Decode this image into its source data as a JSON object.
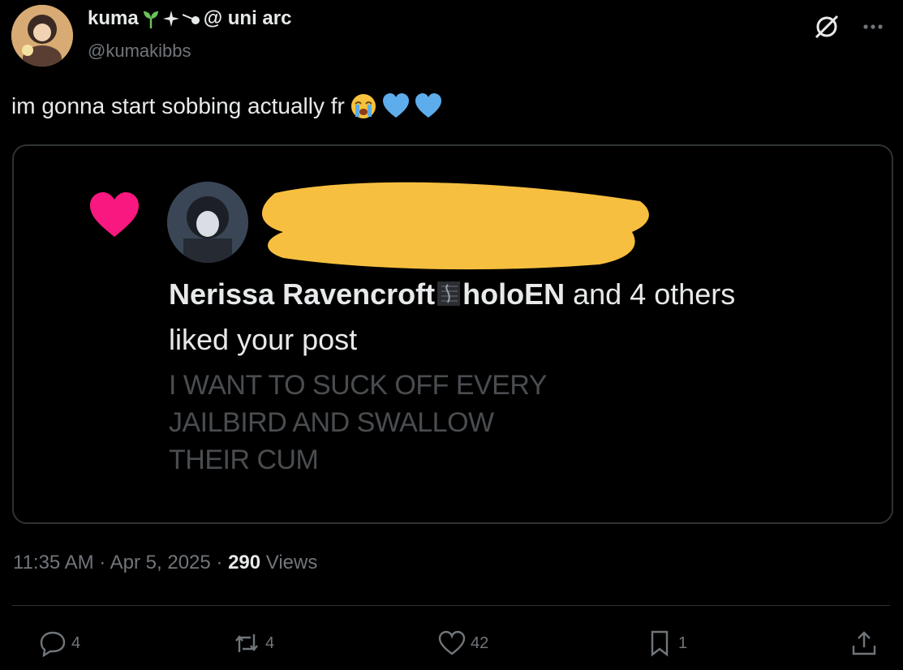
{
  "author": {
    "name": "kuma",
    "name_suffix": "@ uni arc",
    "handle": "@kumakibbs"
  },
  "tweet": {
    "text": "im gonna start sobbing actually fr",
    "emojis": [
      "loudly-crying-face",
      "blue-heart",
      "blue-heart"
    ]
  },
  "embedded_screenshot": {
    "liker_name": "Nerissa Ravencroft",
    "liker_affiliation": "holoEN",
    "liker_rest": " and 4 others",
    "action_text": "liked your post",
    "quoted_lines": [
      "I WANT TO SUCK OFF EVERY",
      "JAILBIRD AND SWALLOW",
      "THEIR CUM"
    ],
    "heart_color": "#f91880",
    "redaction_color": "#f6bf3f"
  },
  "meta": {
    "time": "11:35 AM",
    "sep1": " · ",
    "date": "Apr 5, 2025",
    "sep2": " · ",
    "views_count": "290",
    "views_label": " Views"
  },
  "actions": {
    "replies": "4",
    "reposts": "4",
    "likes": "42",
    "bookmarks": "1"
  },
  "colors": {
    "background": "#000000",
    "text_primary": "#e7e9ea",
    "text_secondary": "#71767b",
    "border": "#2f3336"
  }
}
